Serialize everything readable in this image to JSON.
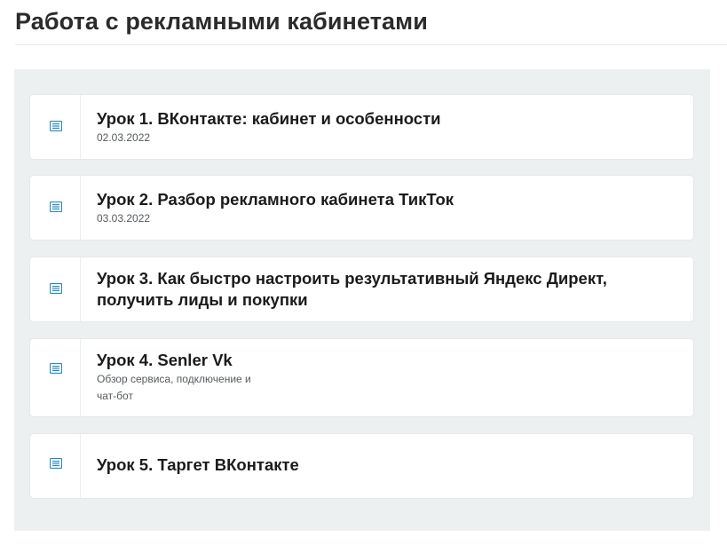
{
  "header": {
    "title": "Работа с рекламными кабинетами"
  },
  "lessons": [
    {
      "title": "Урок 1. ВКонтакте: кабинет и особенности",
      "subtitle": "02.03.2022"
    },
    {
      "title": "Урок 2. Разбор рекламного кабинета ТикТок",
      "subtitle": "03.03.2022"
    },
    {
      "title_line1": "Урок 3. Как быстро настроить результативный Яндекс Директ,",
      "title_line2": "получить лиды и покупки"
    },
    {
      "title": "Урок 4. Senler Vk",
      "subtitle_line1": "Обзор сервиса, подключение и",
      "subtitle_line2": "чат-бот"
    },
    {
      "title": "Урок 5. Таргет ВКонтакте"
    }
  ],
  "icons": {
    "lesson": "text-document-icon"
  },
  "colors": {
    "icon": "#2a8bbd",
    "panel_background": "#edf0f1",
    "card_background": "#ffffff"
  }
}
